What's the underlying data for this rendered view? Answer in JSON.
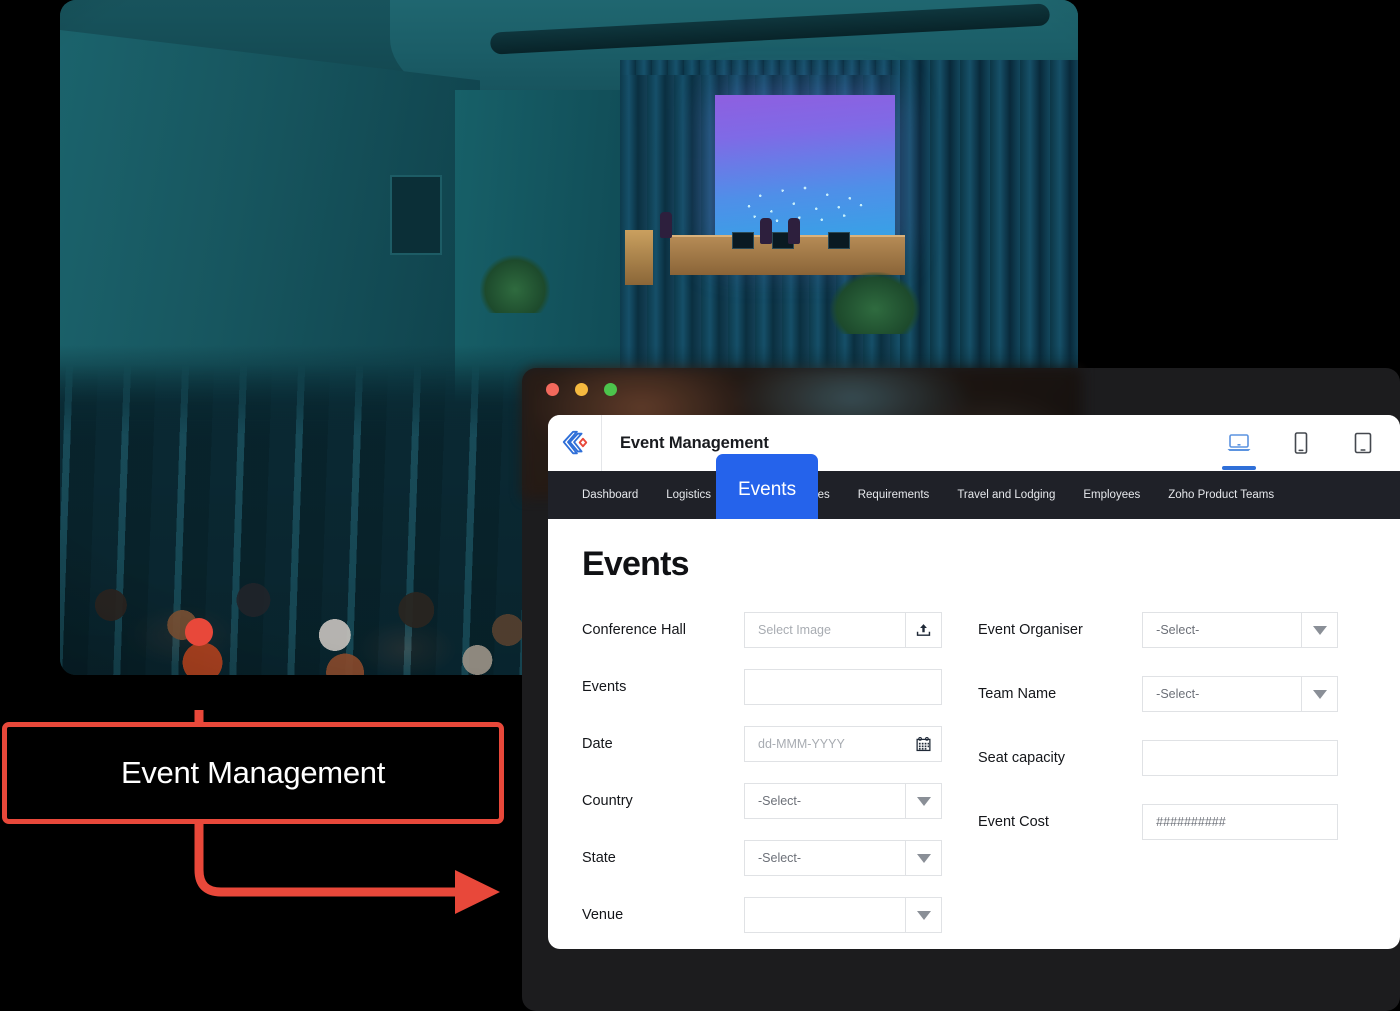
{
  "window": {
    "traffic_lights": [
      "close-red",
      "minimize-yellow",
      "maximize-green"
    ]
  },
  "app": {
    "logo_icon": "zoho-creator-diamond-logo",
    "title": "Event Management",
    "device_views": [
      {
        "icon": "laptop-icon",
        "label": "Desktop view",
        "active": true
      },
      {
        "icon": "mobile-phone-icon",
        "label": "Mobile view",
        "active": false
      },
      {
        "icon": "tablet-icon",
        "label": "Tablet view",
        "active": false
      }
    ],
    "nav": {
      "items": [
        {
          "label": "Dashboard",
          "active": false
        },
        {
          "label": "Logistics",
          "active": false
        },
        {
          "label": "Events",
          "active": true
        },
        {
          "label": "ies",
          "active": false
        },
        {
          "label": "Requirements",
          "active": false
        },
        {
          "label": "Travel and Lodging",
          "active": false
        },
        {
          "label": "Employees",
          "active": false
        },
        {
          "label": "Zoho Product Teams",
          "active": false
        }
      ]
    },
    "page_title": "Events",
    "form": {
      "left_column": [
        {
          "label": "Conference Hall",
          "type": "file",
          "value": "",
          "placeholder": "Select Image",
          "addon_icon": "upload-icon"
        },
        {
          "label": "Events",
          "type": "text",
          "value": "",
          "placeholder": ""
        },
        {
          "label": "Date",
          "type": "date",
          "value": "",
          "placeholder": "dd-MMM-YYYY",
          "addon_icon": "calendar-icon"
        },
        {
          "label": "Country",
          "type": "select",
          "value": "-Select-",
          "addon_icon": "chevron-down-icon"
        },
        {
          "label": "State",
          "type": "select",
          "value": "-Select-",
          "addon_icon": "chevron-down-icon"
        },
        {
          "label": "Venue",
          "type": "select",
          "value": "",
          "addon_icon": "chevron-down-icon"
        }
      ],
      "right_column": [
        {
          "label": "Event Organiser",
          "type": "select",
          "value": "-Select-",
          "addon_icon": "chevron-down-icon"
        },
        {
          "label": "Team Name",
          "type": "select",
          "value": "-Select-",
          "addon_icon": "chevron-down-icon"
        },
        {
          "label": "Seat capacity",
          "type": "text",
          "value": "",
          "placeholder": ""
        },
        {
          "label": "Event Cost",
          "type": "currency",
          "value": "##########",
          "placeholder": ""
        }
      ]
    }
  },
  "annotation": {
    "label": "Event Management",
    "accent_color": "#e8483a",
    "background_color": "#000000",
    "text_color": "#ffffff"
  },
  "photo": {
    "alt": "conference-auditorium-photo"
  },
  "colors": {
    "nav_background": "#1f2128",
    "active_tab": "#2563eb",
    "page_background": "#000000",
    "card_background": "#ffffff",
    "window_frame": "#1c1c1e",
    "field_border": "#e0e2e5",
    "placeholder_text": "#a8acb2"
  }
}
